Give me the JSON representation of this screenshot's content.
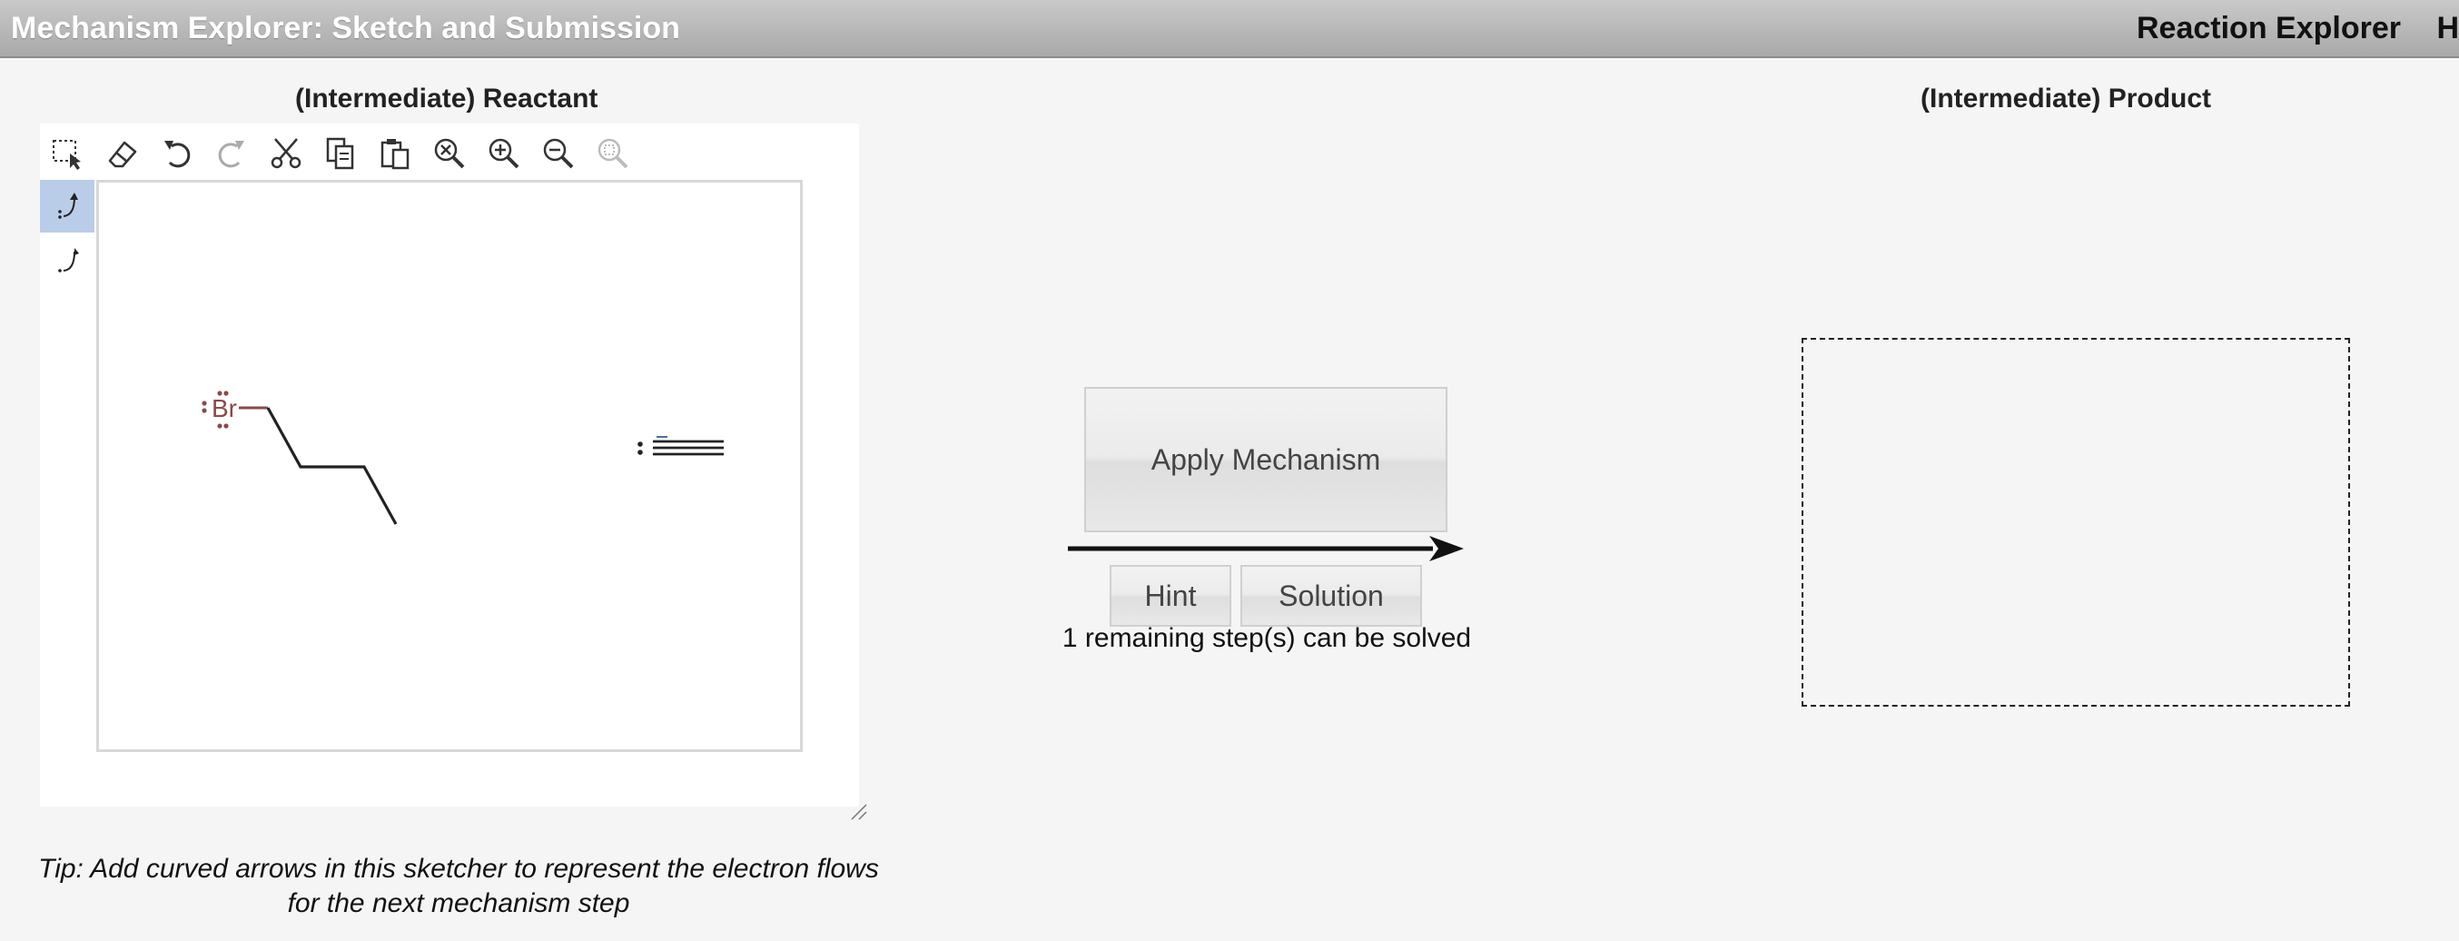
{
  "header": {
    "title": "Mechanism Explorer: Sketch and Submission",
    "nav": [
      "Reaction Explorer",
      "H"
    ]
  },
  "reactant": {
    "title": "(Intermediate) Reactant",
    "toolbar": [
      "select-icon",
      "eraser-icon",
      "undo-icon",
      "redo-icon",
      "cut-icon",
      "copy-icon",
      "paste-icon",
      "zoom-reset-icon",
      "zoom-in-icon",
      "zoom-out-icon",
      "zoom-fit-icon"
    ],
    "arrow_tools": [
      "pair-arrow-icon",
      "single-electron-arrow-icon"
    ],
    "molecule": {
      "atom_label": "Br"
    },
    "tip": "Tip: Add curved arrows in this sketcher to represent the electron flows for the next mechanism step"
  },
  "actions": {
    "apply_label": "Apply Mechanism",
    "hint_label": "Hint",
    "solution_label": "Solution",
    "status": "1 remaining step(s) can be solved"
  },
  "product": {
    "title": "(Intermediate) Product"
  },
  "colors": {
    "header_bg": "#b5b5b5",
    "page_bg": "#f5f5f5",
    "active_tool": "#b9cde8",
    "bromine": "#8b4a4a"
  }
}
